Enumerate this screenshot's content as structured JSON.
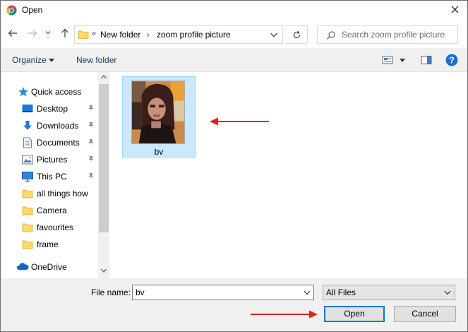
{
  "window": {
    "title": "Open"
  },
  "address": {
    "crumbs": [
      "New folder",
      "zoom profile picture"
    ],
    "overflow_chevron": "«",
    "separator": "›"
  },
  "search": {
    "placeholder": "Search zoom profile picture"
  },
  "toolbar": {
    "organize_label": "Organize",
    "new_folder_label": "New folder"
  },
  "nav_pane": {
    "items": [
      {
        "label": "Quick access",
        "icon": "star-icon"
      },
      {
        "label": "Desktop",
        "icon": "desktop-icon",
        "pinned": true
      },
      {
        "label": "Downloads",
        "icon": "download-icon",
        "pinned": true
      },
      {
        "label": "Documents",
        "icon": "documents-icon",
        "pinned": true
      },
      {
        "label": "Pictures",
        "icon": "pictures-icon",
        "pinned": true
      },
      {
        "label": "This PC",
        "icon": "computer-icon",
        "pinned": true
      },
      {
        "label": "all things how",
        "icon": "folder-icon"
      },
      {
        "label": "Camera",
        "icon": "folder-icon"
      },
      {
        "label": "favourites",
        "icon": "folder-icon"
      },
      {
        "label": "frame",
        "icon": "folder-icon"
      },
      {
        "label": "OneDrive",
        "icon": "cloud-icon"
      }
    ]
  },
  "files": [
    {
      "name": "bv",
      "selected": true
    }
  ],
  "bottom": {
    "file_name_label": "File name:",
    "file_name_value": "bv",
    "file_type": "All Files",
    "open_label": "Open",
    "cancel_label": "Cancel"
  },
  "colors": {
    "selection": "#cce8ff",
    "accent": "#0078d7",
    "annotation_arrow": "#e0211d"
  }
}
